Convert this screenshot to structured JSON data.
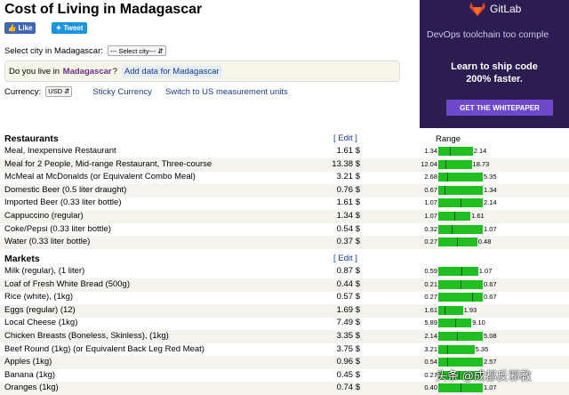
{
  "page": {
    "title": "Cost of Living in Madagascar"
  },
  "social": {
    "like": "Like",
    "tweet": "Tweet"
  },
  "city_selector": {
    "label": "Select city in Madagascar:",
    "value": "--- Select city---"
  },
  "live_box": {
    "prefix": "Do you live in",
    "country": "Madagascar",
    "suffix": "?",
    "add_data": "Add data for Madagascar"
  },
  "currency": {
    "label": "Currency:",
    "value": "USD",
    "sticky": "Sticky Currency",
    "units": "Switch to US measurement units"
  },
  "ad": {
    "brand": "GitLab",
    "subtitle": "DevOps toolchain too comple",
    "headline_1": "Learn to ship code",
    "headline_2": "200% faster.",
    "cta": "GET THE WHITEPAPER",
    "colors": {
      "bg": "#2b1c52",
      "cta": "#6e49cb",
      "logo": "#e24329"
    }
  },
  "restaurants": {
    "heading": "Restaurants",
    "edit": "[ Edit ]",
    "range_label": "Range",
    "rows": [
      {
        "name": "Meal, Inexpensive Restaurant",
        "price": "1.61 $",
        "min": "1.34",
        "max": "2.14",
        "min_v": 1.34,
        "max_v": 2.14,
        "val": 1.61
      },
      {
        "name": "Meal for 2 People, Mid-range Restaurant, Three-course",
        "price": "13.38 $",
        "min": "12.04",
        "max": "18.73",
        "min_v": 12.04,
        "max_v": 18.73,
        "val": 13.38
      },
      {
        "name": "McMeal at McDonalds (or Equivalent Combo Meal)",
        "price": "3.21 $",
        "min": "2.68",
        "max": "5.35",
        "min_v": 2.68,
        "max_v": 5.35,
        "val": 3.21
      },
      {
        "name": "Domestic Beer (0.5 liter draught)",
        "price": "0.76 $",
        "min": "0.67",
        "max": "1.34",
        "min_v": 0.67,
        "max_v": 1.34,
        "val": 0.76
      },
      {
        "name": "Imported Beer (0.33 liter bottle)",
        "price": "1.61 $",
        "min": "1.07",
        "max": "2.14",
        "min_v": 1.07,
        "max_v": 2.14,
        "val": 1.61
      },
      {
        "name": "Cappuccino (regular)",
        "price": "1.34 $",
        "min": "1.07",
        "max": "1.61",
        "min_v": 1.07,
        "max_v": 1.61,
        "val": 1.34
      },
      {
        "name": "Coke/Pepsi (0.33 liter bottle)",
        "price": "0.54 $",
        "min": "0.32",
        "max": "1.07",
        "min_v": 0.32,
        "max_v": 1.07,
        "val": 0.54
      },
      {
        "name": "Water (0.33 liter bottle)",
        "price": "0.37 $",
        "min": "0.27",
        "max": "0.48",
        "min_v": 0.27,
        "max_v": 0.48,
        "val": 0.37
      }
    ]
  },
  "markets": {
    "heading": "Markets",
    "edit": "[ Edit ]",
    "rows": [
      {
        "name": "Milk (regular), (1 liter)",
        "price": "0.87 $",
        "min": "0.59",
        "max": "1.07",
        "min_v": 0.59,
        "max_v": 1.07,
        "val": 0.87
      },
      {
        "name": "Loaf of Fresh White Bread (500g)",
        "price": "0.44 $",
        "min": "0.21",
        "max": "0.67",
        "min_v": 0.21,
        "max_v": 0.67,
        "val": 0.44
      },
      {
        "name": "Rice (white), (1kg)",
        "price": "0.57 $",
        "min": "0.27",
        "max": "0.67",
        "min_v": 0.27,
        "max_v": 0.67,
        "val": 0.57
      },
      {
        "name": "Eggs (regular) (12)",
        "price": "1.69 $",
        "min": "1.61",
        "max": "1.93",
        "min_v": 1.61,
        "max_v": 1.93,
        "val": 1.69
      },
      {
        "name": "Local Cheese (1kg)",
        "price": "7.49 $",
        "min": "5.89",
        "max": "9.10",
        "min_v": 5.89,
        "max_v": 9.1,
        "val": 7.49
      },
      {
        "name": "Chicken Breasts (Boneless, Skinless), (1kg)",
        "price": "3.35 $",
        "min": "2.14",
        "max": "5.08",
        "min_v": 2.14,
        "max_v": 5.08,
        "val": 3.35
      },
      {
        "name": "Beef Round (1kg) (or Equivalent Back Leg Red Meat)",
        "price": "3.75 $",
        "min": "3.21",
        "max": "5.35",
        "min_v": 3.21,
        "max_v": 5.35,
        "val": 3.75
      },
      {
        "name": "Apples (1kg)",
        "price": "0.96 $",
        "min": "0.54",
        "max": "2.57",
        "min_v": 0.54,
        "max_v": 2.57,
        "val": 0.96
      },
      {
        "name": "Banana (1kg)",
        "price": "0.45 $",
        "min": "0.27",
        "max": "",
        "min_v": 0.27,
        "max_v": 0.67,
        "val": 0.45
      },
      {
        "name": "Oranges (1kg)",
        "price": "0.74 $",
        "min": "0.40",
        "max": "1.07",
        "min_v": 0.4,
        "max_v": 1.07,
        "val": 0.74
      }
    ]
  },
  "watermark": "头条 @成都反邪教",
  "colors": {
    "bar": "#1fbf1f",
    "link": "#1a3b8a",
    "alt_row": "#f4f3ee"
  }
}
